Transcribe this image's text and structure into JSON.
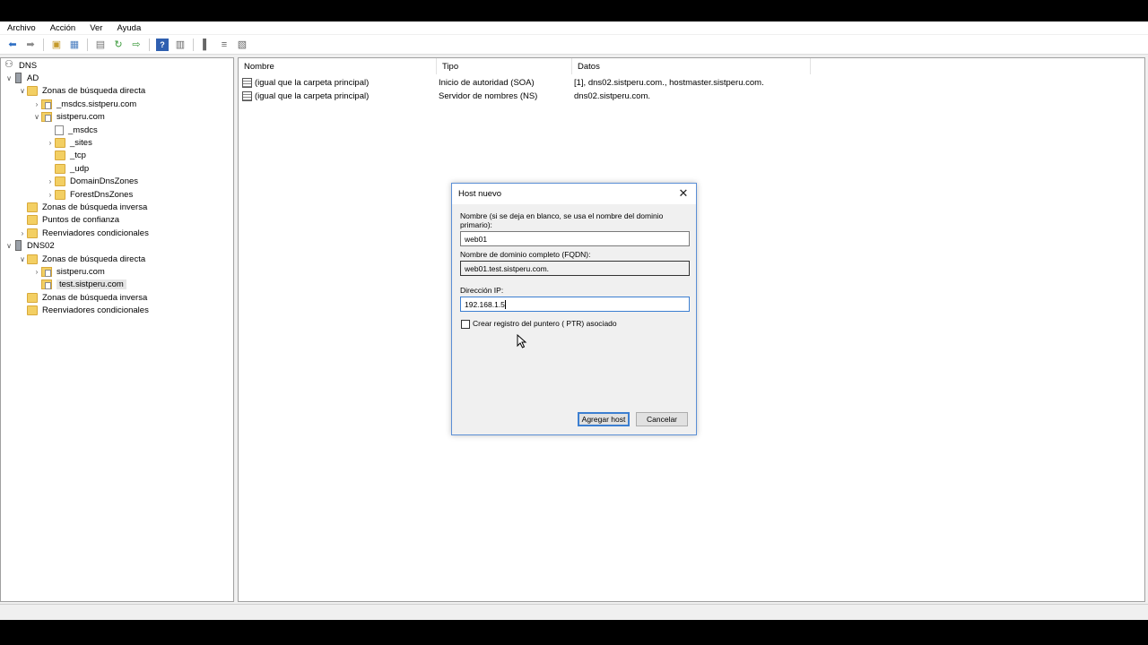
{
  "menu": [
    "Archivo",
    "Acción",
    "Ver",
    "Ayuda"
  ],
  "tree": {
    "root": "DNS",
    "nodes": [
      {
        "label": "AD",
        "icon": "server"
      },
      {
        "label": "Zonas de búsqueda directa",
        "icon": "folder"
      },
      {
        "label": "_msdcs.sistperu.com",
        "icon": "zone"
      },
      {
        "label": "sistperu.com",
        "icon": "zone"
      },
      {
        "label": "_msdcs",
        "icon": "doc"
      },
      {
        "label": "_sites",
        "icon": "folder"
      },
      {
        "label": "_tcp",
        "icon": "folder"
      },
      {
        "label": "_udp",
        "icon": "folder"
      },
      {
        "label": "DomainDnsZones",
        "icon": "folder"
      },
      {
        "label": "ForestDnsZones",
        "icon": "folder"
      },
      {
        "label": "Zonas de búsqueda inversa",
        "icon": "folder"
      },
      {
        "label": "Puntos de confianza",
        "icon": "folder"
      },
      {
        "label": "Reenviadores condicionales",
        "icon": "folder"
      },
      {
        "label": "DNS02",
        "icon": "server"
      },
      {
        "label": "Zonas de búsqueda directa",
        "icon": "folder"
      },
      {
        "label": "sistperu.com",
        "icon": "zone"
      },
      {
        "label": "test.sistperu.com",
        "icon": "zone"
      },
      {
        "label": "Zonas de búsqueda inversa",
        "icon": "folder"
      },
      {
        "label": "Reenviadores condicionales",
        "icon": "folder"
      }
    ]
  },
  "list": {
    "columns": [
      "Nombre",
      "Tipo",
      "Datos"
    ],
    "rows": [
      {
        "name": "(igual que la carpeta principal)",
        "type": "Inicio de autoridad (SOA)",
        "data": "[1], dns02.sistperu.com., hostmaster.sistperu.com."
      },
      {
        "name": "(igual que la carpeta principal)",
        "type": "Servidor de nombres (NS)",
        "data": "dns02.sistperu.com."
      }
    ]
  },
  "dialog": {
    "title": "Host nuevo",
    "name_label": "Nombre (si se deja en blanco, se usa el nombre del dominio primario):",
    "name_value": "web01",
    "fqdn_label": "Nombre de dominio completo (FQDN):",
    "fqdn_value": "web01.test.sistperu.com.",
    "ip_label": "Dirección IP:",
    "ip_value": "192.168.1.5",
    "ptr_label": "Crear registro del puntero ( PTR) asociado",
    "ptr_checked": false,
    "add_button": "Agregar host",
    "cancel_button": "Cancelar"
  }
}
